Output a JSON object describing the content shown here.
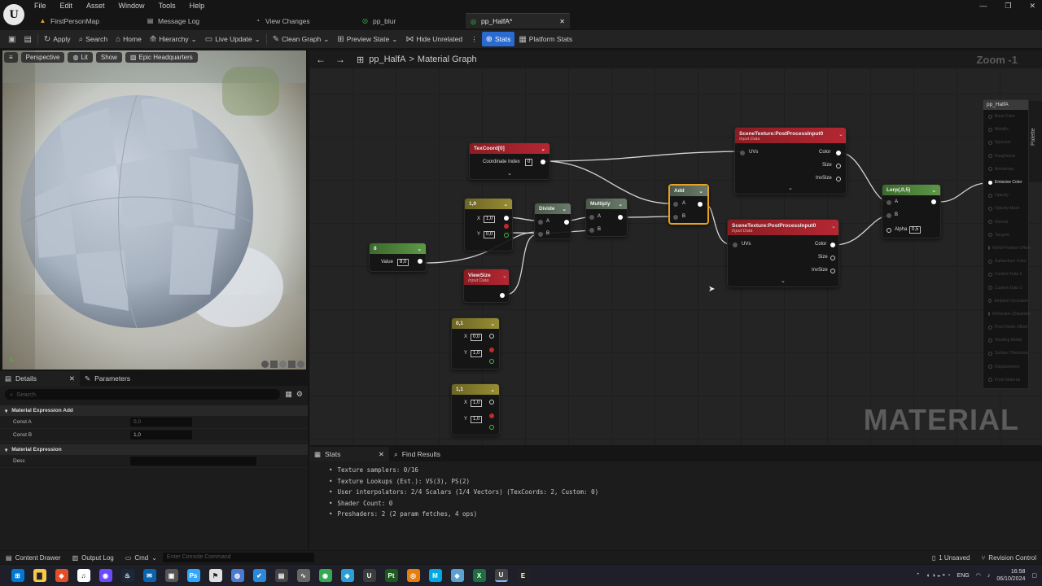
{
  "menu": [
    "File",
    "Edit",
    "Asset",
    "Window",
    "Tools",
    "Help"
  ],
  "tabs": [
    {
      "label": "FirstPersonMap",
      "icon": "map-icon"
    },
    {
      "label": "Message Log",
      "icon": "log-icon"
    },
    {
      "label": "View Changes",
      "icon": "check-circle-icon"
    },
    {
      "label": "pp_blur",
      "icon": "material-icon"
    },
    {
      "label": "pp_HalfA*",
      "icon": "material-icon",
      "active": true
    }
  ],
  "toolbar": {
    "apply": "Apply",
    "search": "Search",
    "home": "Home",
    "hierarchy": "Hierarchy",
    "live_update": "Live Update",
    "clean_graph": "Clean Graph",
    "preview_state": "Preview State",
    "hide_unrelated": "Hide Unrelated",
    "stats": "Stats",
    "platform_stats": "Platform Stats"
  },
  "viewport": {
    "perspective": "Perspective",
    "lit": "Lit",
    "show": "Show",
    "hdri": "Epic Headquarters"
  },
  "details": {
    "tab_details": "Details",
    "tab_parameters": "Parameters",
    "search_placeholder": "Search",
    "cat1": "Material Expression Add",
    "const_a_label": "Const A",
    "const_a_value": "0,0",
    "const_b_label": "Const B",
    "const_b_value": "1,0",
    "cat2": "Material Expression",
    "desc_label": "Desc",
    "desc_value": ""
  },
  "graph": {
    "breadcrumb_asset": "pp_HalfA",
    "breadcrumb_sep": ">",
    "breadcrumb_view": "Material Graph",
    "zoom": "Zoom -1",
    "watermark": "MATERIAL",
    "side_label": "Palette"
  },
  "nodes": {
    "texcoord": {
      "title": "TexCoord[0]",
      "pin": "Coordinate Index",
      "value": "0"
    },
    "const8": {
      "title": "8",
      "pin": "Value",
      "value": "8,0"
    },
    "v10": {
      "title": "1,0",
      "x_label": "X",
      "x": "1,0",
      "y_label": "Y",
      "y": "0,0"
    },
    "divide": {
      "title": "Divide",
      "a": "A",
      "b": "B"
    },
    "multiply": {
      "title": "Multiply",
      "a": "A",
      "b": "B"
    },
    "add": {
      "title": "Add",
      "a": "A",
      "b": "B"
    },
    "viewsize": {
      "title": "ViewSize",
      "sub": "Input Data"
    },
    "v01": {
      "title": "0,1",
      "x_label": "X",
      "x": "0,0",
      "y_label": "Y",
      "y": "1,0"
    },
    "v11": {
      "title": "1,1",
      "x_label": "X",
      "x": "1,0",
      "y_label": "Y",
      "y": "1,0"
    },
    "st1": {
      "title": "SceneTexture:PostProcessInput0",
      "sub": "Input Data",
      "uvs": "UVs",
      "color": "Color",
      "size": "Size",
      "invsize": "InvSize"
    },
    "st2": {
      "title": "SceneTexture:PostProcessInput0",
      "sub": "Input Data",
      "uvs": "UVs",
      "color": "Color",
      "size": "Size",
      "invsize": "InvSize"
    },
    "lerp": {
      "title": "Lerp(,0,5)",
      "a": "A",
      "b": "B",
      "alpha": "Alpha",
      "alpha_value": "0,5"
    }
  },
  "result_node": {
    "title": "pp_HalfA",
    "pins": [
      "Base Color",
      "Metallic",
      "Specular",
      "Roughness",
      "Anisotropy",
      "Emissive Color",
      "Opacity",
      "Opacity Mask",
      "Normal",
      "Tangent",
      "World Position Offset",
      "Subsurface Color",
      "Custom Data 0",
      "Custom Data 1",
      "Ambient Occlusion",
      "Refraction (Disabled)",
      "Pixel Depth Offset",
      "Shading Model",
      "Surface Thickness",
      "Displacement",
      "Front Material"
    ],
    "active_index": 5
  },
  "stats": {
    "tab_stats": "Stats",
    "tab_find": "Find Results",
    "lines": [
      "Texture samplers: 0/16",
      "Texture Lookups (Est.): VS(3), PS(2)",
      "User interpolators: 2/4 Scalars (1/4 Vectors) (TexCoords: 2, Custom: 0)",
      "Shader Count: 0",
      "Preshaders: 2  (2 param fetches, 4 ops)"
    ]
  },
  "statusbar": {
    "content_drawer": "Content Drawer",
    "output_log": "Output Log",
    "cmd": "Cmd",
    "console_placeholder": "Enter Console Command",
    "unsaved": "1 Unsaved",
    "revision": "Revision Control"
  },
  "taskbar": {
    "icons": [
      "windows-icon",
      "file-explorer-icon",
      "brave-icon",
      "itunes-icon",
      "obs-icon",
      "steam-icon",
      "outlook-icon",
      "hwmonitor-icon",
      "photoshop-icon",
      "maps-icon",
      "app-icon",
      "todo-icon",
      "screen-capture-icon",
      "live-icon",
      "chrome-icon",
      "unreal-project-icon",
      "ue-icon",
      "pt-icon",
      "blender-icon",
      "m-icon",
      "cube-icon",
      "excel-icon",
      "unreal-editor-icon",
      "epic-icon"
    ],
    "lang": "ENG",
    "time": "16:58",
    "date": "06/10/2024"
  },
  "colors": {
    "accent": "#2a6bd1",
    "node_red": "#b42733",
    "node_yellow": "#978d34",
    "node_green": "#5d9846",
    "selection": "#e8a020"
  }
}
